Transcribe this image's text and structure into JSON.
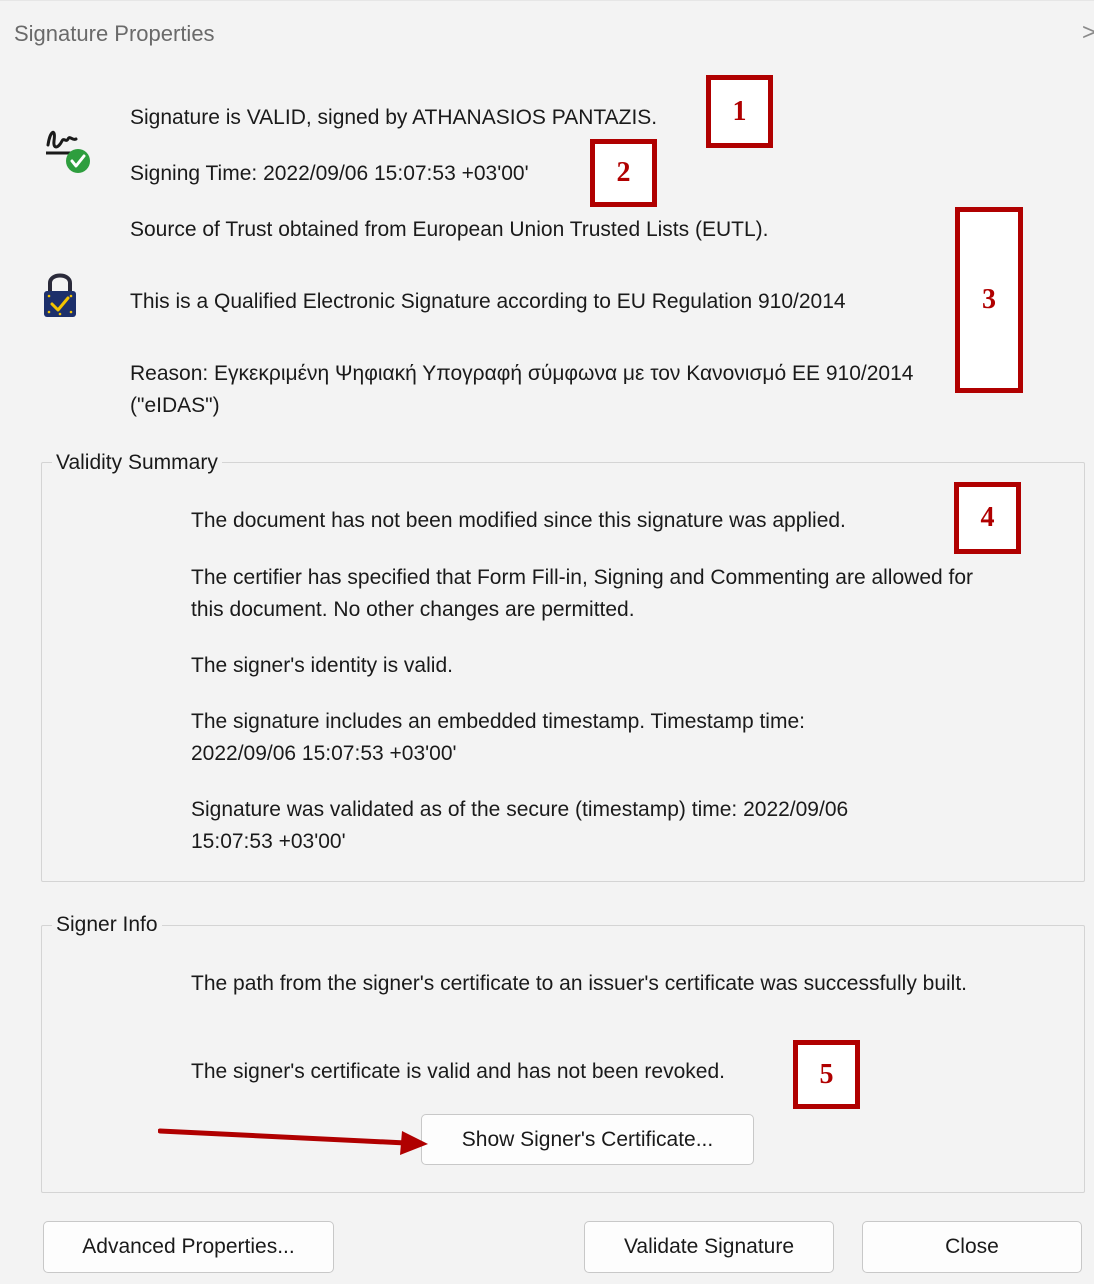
{
  "window": {
    "title": "Signature Properties",
    "close_glyph": ">"
  },
  "header": {
    "status_line": "Signature is VALID, signed by ATHANASIOS PANTAZIS.",
    "signing_time": "Signing Time:  2022/09/06 15:07:53 +03'00'",
    "trust_source": "Source of Trust obtained from European Union Trusted Lists (EUTL).",
    "qualified": "This is a Qualified Electronic Signature according to EU Regulation 910/2014",
    "reason": "Reason:  Εγκεκριμένη Ψηφιακή Υπογραφή σύμφωνα με τον Κανονισμό ΕΕ 910/2014 (\"eIDAS\")",
    "signature_icon": "signature-valid-icon",
    "eu_lock_icon": "eu-trust-lock-icon"
  },
  "validity_summary": {
    "legend": "Validity Summary",
    "lines": [
      "The document has not been modified since this signature was applied.",
      "The certifier has specified that Form Fill-in, Signing and Commenting are allowed for this document. No other changes are permitted.",
      "The signer's identity is valid.",
      "The signature includes an embedded timestamp. Timestamp time: 2022/09/06 15:07:53 +03'00'",
      "Signature was validated as of the secure (timestamp) time: 2022/09/06 15:07:53 +03'00'"
    ]
  },
  "signer_info": {
    "legend": "Signer Info",
    "lines": [
      "The path from the signer's certificate to an issuer's certificate was successfully built.",
      "The signer's certificate is valid and has not been revoked."
    ],
    "show_certificate_button": "Show Signer's Certificate..."
  },
  "footer": {
    "advanced_button": "Advanced Properties...",
    "validate_button": "Validate Signature",
    "close_button": "Close"
  },
  "annotations": {
    "markers": [
      "1",
      "2",
      "3",
      "4",
      "5"
    ],
    "marker_color": "#b00000",
    "arrow_color": "#b00000"
  }
}
